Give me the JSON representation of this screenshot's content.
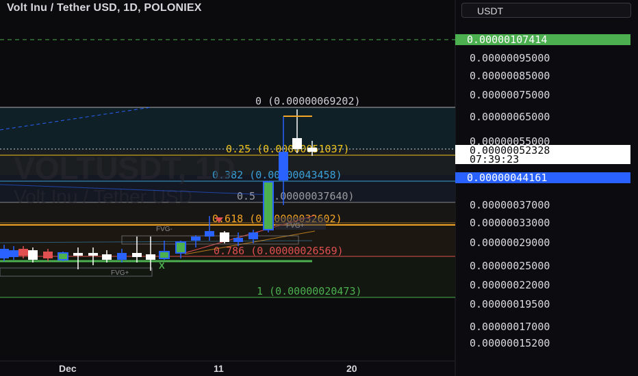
{
  "header": {
    "title": "Volt Inu / Tether USD, 1D, POLONIEX",
    "currency_button": "USDT"
  },
  "watermark": {
    "line1": "VOLTUSDT, 1D",
    "line2": "Volt Inu / Tether USD"
  },
  "price_axis": {
    "labels": [
      "0.00000095000",
      "0.00000085000",
      "0.00000075000",
      "0.00000065000",
      "0.00000055000",
      "0.00000037000",
      "0.00000033000",
      "0.00000029000",
      "0.00000025000",
      "0.00000022000",
      "0.00000019500",
      "0.00000017000",
      "0.00000015200"
    ],
    "badge_high": {
      "value": "0.00000107414",
      "color": "#4caf50"
    },
    "badge_current": {
      "value": "0.00000052328",
      "countdown": "07:39:23",
      "color": "#ffffff"
    },
    "badge_blue": {
      "value": "0.00000044161",
      "color": "#2962ff"
    }
  },
  "time_axis": {
    "labels": [
      "Dec",
      "11",
      "20"
    ]
  },
  "fib_levels": [
    {
      "label": "0 (0.00000069202)",
      "color": "#d0d0d4"
    },
    {
      "label": "0.25 (0.00000051037)",
      "color": "#f0c419"
    },
    {
      "label": "0.382 (0.00000043458)",
      "color": "#3aa0d8"
    },
    {
      "label": "0.5 (0.00000037640)",
      "color": "#9b9ba0"
    },
    {
      "label": "0.618 (0.00000032602)",
      "color": "#f5a623"
    },
    {
      "label": "0.786 (0.00000026569)",
      "color": "#e05050"
    },
    {
      "label": "1 (0.00000020473)",
      "color": "#4caf50"
    }
  ],
  "annotations": {
    "fvg_minus": "FVG-",
    "fvg_plus_a": "FVG+",
    "fvg_plus_b": "FVG+",
    "cross_mark": "X"
  }
}
